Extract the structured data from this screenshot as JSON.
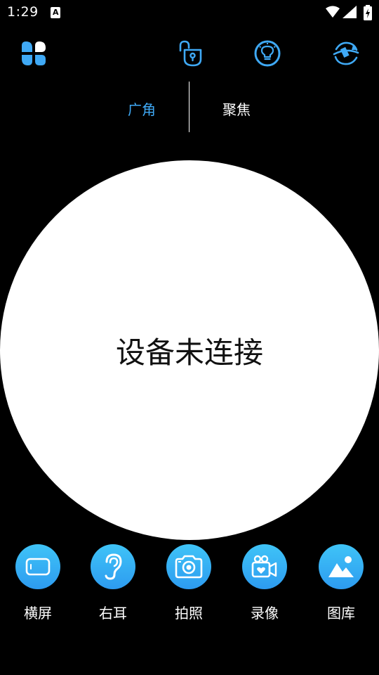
{
  "status_bar": {
    "time": "1:29",
    "notification_letter": "A"
  },
  "toolbar": {
    "icons": [
      "app-menu-icon",
      "unlock-icon",
      "light-bulb-icon",
      "rotate-icon"
    ],
    "accent_color": "#3fa9f5"
  },
  "mode_tabs": {
    "wide": "广角",
    "focus": "聚焦",
    "selected": "wide"
  },
  "preview": {
    "status": "设备未连接"
  },
  "actions": {
    "landscape": "横屏",
    "right_ear": "右耳",
    "photo": "拍照",
    "record": "录像",
    "gallery": "图库"
  },
  "colors": {
    "background": "#000000",
    "accent": "#3fa9f5",
    "button_gradient_top": "#3fc4f7",
    "button_gradient_bottom": "#2d9bf0"
  }
}
